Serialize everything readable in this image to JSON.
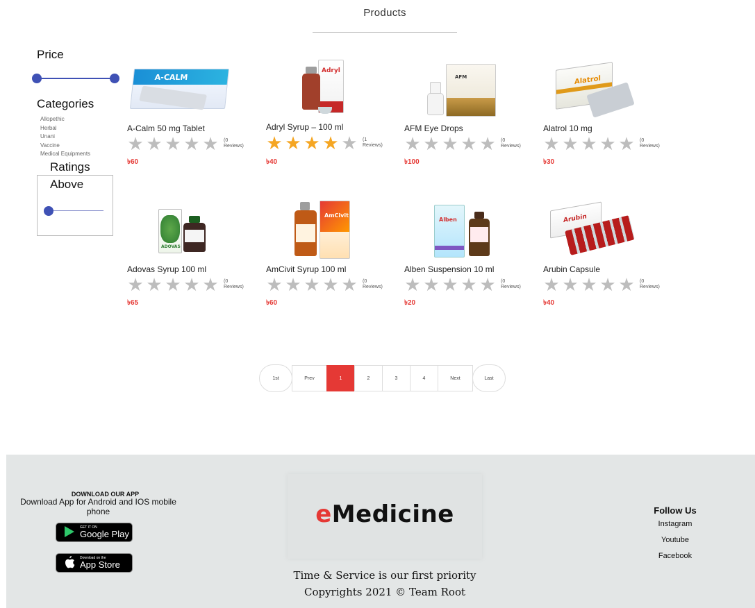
{
  "page": {
    "heading": "Products"
  },
  "sidebar": {
    "price_title": "Price",
    "categories_title": "Categories",
    "categories": [
      "Allopethic",
      "Herbal",
      "Unani",
      "Vaccine",
      "Medical Equipments"
    ],
    "ratings_title": "Ratings",
    "ratings_above_label": "Above",
    "price_range": [
      0,
      1
    ],
    "ratings_above_value": 0
  },
  "products": [
    {
      "name": "A-Calm 50 mg Tablet",
      "rating": 0,
      "reviews": "(0 Reviews)",
      "price": "৳60",
      "image_label": "A-CALM"
    },
    {
      "name": "Adryl Syrup – 100 ml",
      "rating": 4,
      "reviews": "(1 Reviews)",
      "price": "৳40",
      "image_label": "Adryl"
    },
    {
      "name": "AFM Eye Drops",
      "rating": 0,
      "reviews": "(0 Reviews)",
      "price": "৳100",
      "image_label": "AFM"
    },
    {
      "name": "Alatrol 10 mg",
      "rating": 0,
      "reviews": "(0 Reviews)",
      "price": "৳30",
      "image_label": "Alatrol"
    },
    {
      "name": "Adovas Syrup 100 ml",
      "rating": 0,
      "reviews": "(0 Reviews)",
      "price": "৳65",
      "image_label": "ADOVAS"
    },
    {
      "name": "AmCivit Syrup 100 ml",
      "rating": 0,
      "reviews": "(0 Reviews)",
      "price": "৳60",
      "image_label": "AmCivit"
    },
    {
      "name": "Alben Suspension 10 ml",
      "rating": 0,
      "reviews": "(0 Reviews)",
      "price": "৳20",
      "image_label": "Alben"
    },
    {
      "name": "Arubin Capsule",
      "rating": 0,
      "reviews": "(0 Reviews)",
      "price": "৳40",
      "image_label": "Arubin"
    }
  ],
  "pagination": {
    "first": "1st",
    "prev": "Prev",
    "pages": [
      "1",
      "2",
      "3",
      "4"
    ],
    "active": "1",
    "next": "Next",
    "last": "Last"
  },
  "footer": {
    "app_heading": "DOWNLOAD OUR APP",
    "app_description": "Download App for Android and IOS mobile phone",
    "google_play_small": "GET IT ON",
    "google_play_big": "Google Play",
    "app_store_small": "Download on the",
    "app_store_big": "App Store",
    "logo_first_letter": "e",
    "logo_rest": "Medicine",
    "tagline": "Time & Service is our first priority",
    "copyright": "Copyrights 2021 © Team Root",
    "follow_title": "Follow Us",
    "social": [
      "Instagram",
      "Youtube",
      "Facebook"
    ]
  },
  "colors": {
    "accent": "#3f51b5",
    "price": "#e53935",
    "star": "#f5a623",
    "star_empty": "#bdbdbd",
    "footer_bg": "#e3e6e6"
  }
}
